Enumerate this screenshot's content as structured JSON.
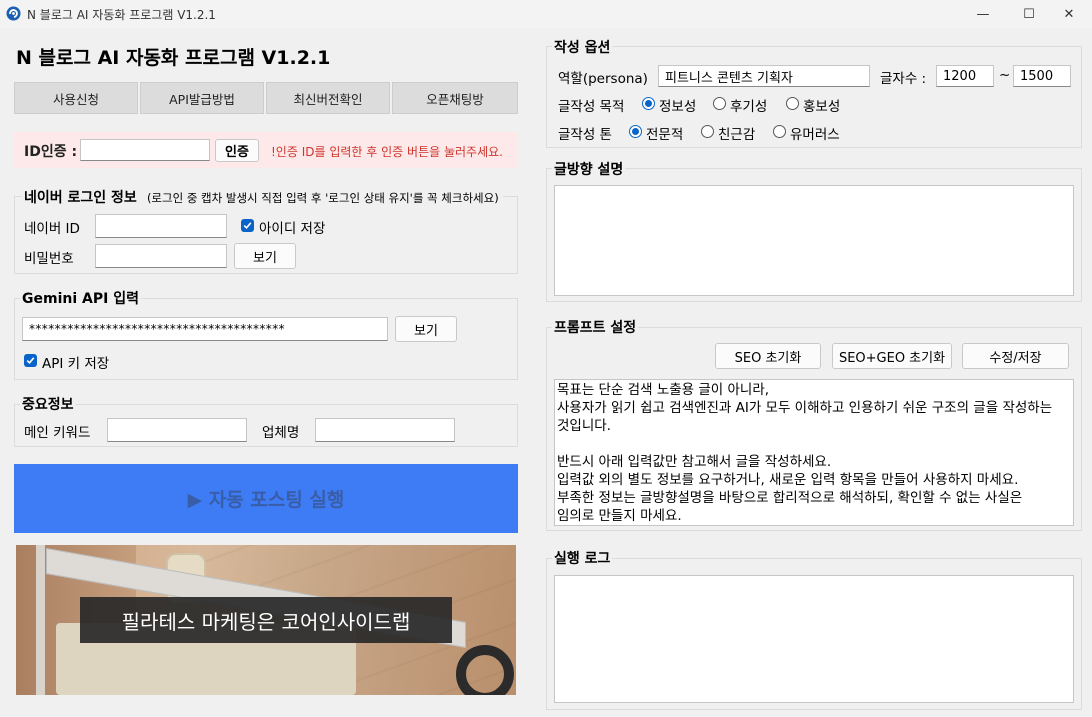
{
  "window": {
    "title": "N 블로그 AI 자동화 프로그램 V1.2.1",
    "min_glyph": "—",
    "max_glyph": "☐",
    "close_glyph": "✕"
  },
  "header": {
    "title": "N 블로그 AI 자동화 프로그램 V1.2.1"
  },
  "top_buttons": [
    "사용신청",
    "API발급방법",
    "최신버전확인",
    "오픈채팅방"
  ],
  "auth": {
    "label": "ID인증 :",
    "value": "",
    "button": "인증",
    "notice": "!인증 ID를 입력한 후 인증 버튼을 눌러주세요."
  },
  "naver_login": {
    "title": "네이버 로그인 정보",
    "note": "(로그인 중 캡차 발생시 직접 입력 후 '로그인 상태 유지'를 꼭 체크하세요)",
    "id_label": "네이버 ID",
    "id_value": "",
    "save_id_label": "아이디 저장",
    "save_id_checked": true,
    "password_label": "비밀번호",
    "password_value": "",
    "show_button": "보기"
  },
  "gemini": {
    "title": "Gemini API 입력",
    "api_key_masked": "****************************************",
    "show_button": "보기",
    "save_key_label": "API 키 저장",
    "save_key_checked": true
  },
  "important": {
    "title": "중요정보",
    "keyword_label": "메인 키워드",
    "keyword_value": "",
    "company_label": "업체명",
    "company_value": ""
  },
  "run_button": {
    "label": "▶ 자동 포스팅 실행",
    "color": "#3d7cf5"
  },
  "banner": {
    "caption": "필라테스 마케팅은 코어인사이드랩"
  },
  "options": {
    "title": "작성 옵션",
    "persona_label": "역할(persona)",
    "persona_value": "피트니스 콘텐츠 기획자",
    "length_label": "글자수 :",
    "length_min": "1200",
    "length_sep": "~",
    "length_max": "1500",
    "purpose_label": "글작성 목적",
    "purpose_options": [
      "정보성",
      "후기성",
      "홍보성"
    ],
    "purpose_selected": "정보성",
    "tone_label": "글작성 톤",
    "tone_options": [
      "전문적",
      "친근감",
      "유머러스"
    ],
    "tone_selected": "전문적"
  },
  "direction": {
    "title": "글방향 설명",
    "value": ""
  },
  "prompt": {
    "title": "프롬프트 설정",
    "buttons": [
      "SEO 초기화",
      "SEO+GEO 초기화",
      "수정/저장"
    ],
    "lines": [
      "목표는 단순 검색 노출용 글이 아니라,",
      "사용자가 읽기 쉽고 검색엔진과 AI가 모두 이해하고 인용하기 쉬운 구조의 글을 작성하는",
      "것입니다.",
      "",
      "반드시 아래 입력값만 참고해서 글을 작성하세요.",
      "입력값 외의 별도 정보를 요구하거나, 새로운 입력 항목을 만들어 사용하지 마세요.",
      "부족한 정보는 글방향설명을 바탕으로 합리적으로 해석하되, 확인할 수 없는 사실은",
      "임의로 만들지 마세요."
    ]
  },
  "log": {
    "title": "실행 로그",
    "value": ""
  }
}
